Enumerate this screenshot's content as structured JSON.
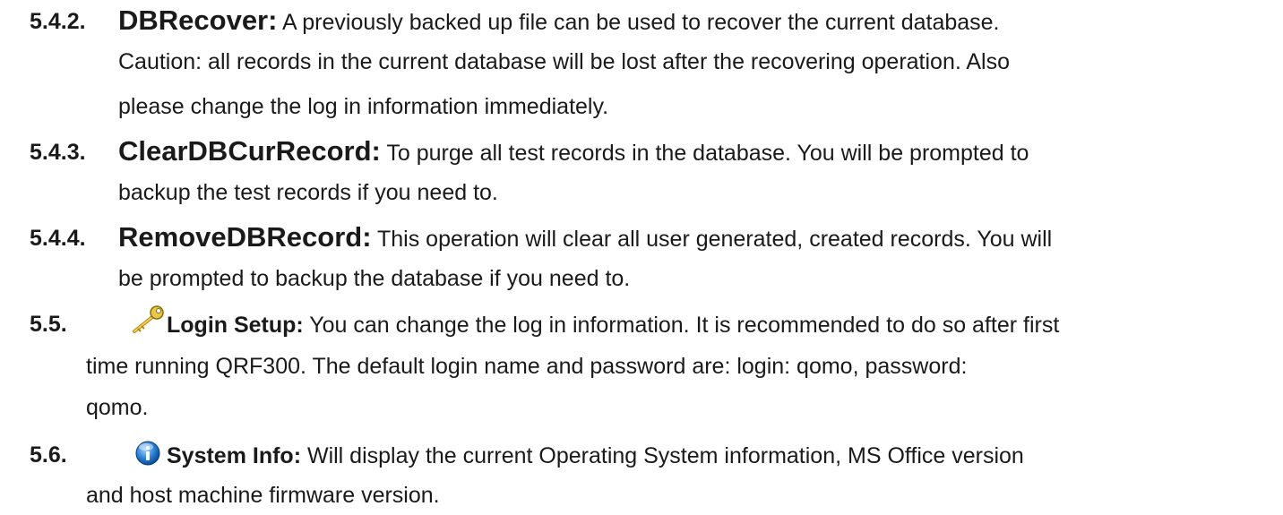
{
  "sections": [
    {
      "number": "5.4.2.",
      "title": "DBRecover:",
      "lines": [
        " A previously backed up file can be used to recover the current database.",
        "Caution: all records in the current database will be lost after the recovering operation. Also",
        "please change the log in information immediately."
      ]
    },
    {
      "number": "5.4.3.",
      "title": "ClearDBCurRecord:",
      "lines": [
        " To purge all test records in the database. You will be prompted to",
        "backup the test records if you need to."
      ]
    },
    {
      "number": "5.4.4.",
      "title": "RemoveDBRecord:",
      "lines": [
        " This operation will clear all user generated, created records. You will",
        "be prompted to backup the database if you need to."
      ]
    },
    {
      "number": "5.5.",
      "icon": "key-icon",
      "title": "Login Setup:",
      "lines": [
        " You can change the log in information. It is recommended to do so after first",
        "time running QRF300. The default login name and password are: login: qomo, password:",
        "qomo."
      ]
    },
    {
      "number": "5.6.",
      "icon": "info-icon",
      "title": "System Info:",
      "lines": [
        " Will display the current Operating System information, MS Office version",
        "and host machine firmware version."
      ]
    }
  ]
}
